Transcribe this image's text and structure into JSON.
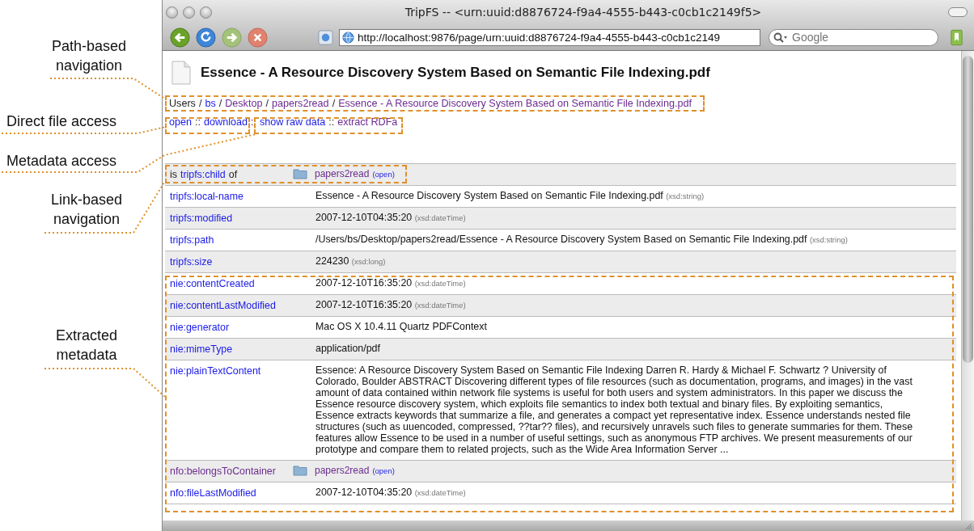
{
  "annotations": [
    {
      "text": "Path-based navigation"
    },
    {
      "text": "Direct file access"
    },
    {
      "text": "Metadata access"
    },
    {
      "text": "Link-based navigation"
    },
    {
      "text": "Extracted metadata"
    }
  ],
  "window": {
    "title": "TripFS -- <urn:uuid:d8876724-f9a4-4555-b443-c0cb1c2149f5>"
  },
  "toolbar": {
    "url": "http://localhost:9876/page/urn:uuid:d8876724-f9a4-4555-b443-c0cb1c2149",
    "search": {
      "placeholder": "Google"
    }
  },
  "page": {
    "title": "Essence - A Resource Discovery System Based on Semantic File Indexing.pdf",
    "breadcrumb": [
      {
        "kind": "text",
        "text": "Users"
      },
      {
        "kind": "separator",
        "text": "/"
      },
      {
        "kind": "link",
        "text": "bs",
        "visited": false
      },
      {
        "kind": "separator",
        "text": "/"
      },
      {
        "kind": "link",
        "text": "Desktop",
        "visited": true
      },
      {
        "kind": "separator",
        "text": "/"
      },
      {
        "kind": "link",
        "text": "papers2read",
        "visited": true
      },
      {
        "kind": "separator",
        "text": "/"
      },
      {
        "kind": "link",
        "text": "Essence - A Resource Discovery System Based on Semantic File Indexing.pdf",
        "visited": true
      }
    ],
    "actions": [
      {
        "kind": "link",
        "text": "open",
        "visited": false
      },
      {
        "kind": "separator",
        "text": "::"
      },
      {
        "kind": "link",
        "text": "download",
        "visited": false
      },
      {
        "kind": "separator",
        "text": "::"
      },
      {
        "kind": "link",
        "text": "show raw data",
        "visited": false
      },
      {
        "kind": "separator",
        "text": "::"
      },
      {
        "kind": "link",
        "text": "extract RDFa",
        "visited": true
      }
    ]
  },
  "table": {
    "rows": [
      {
        "property": {
          "prefix": "is",
          "link": "tripfs:child",
          "suffix": "of",
          "visited": false
        },
        "kind": "resource",
        "value": "papers2read",
        "visited": true,
        "action": "(open)"
      },
      {
        "property": {
          "link": "tripfs:local-name",
          "visited": false
        },
        "kind": "literal",
        "value": "Essence - A Resource Discovery System Based on Semantic File Indexing.pdf",
        "datatype": "(xsd:string)"
      },
      {
        "property": {
          "link": "tripfs:modified",
          "visited": false
        },
        "kind": "literal",
        "value": "2007-12-10T04:35:20",
        "datatype": "(xsd:dateTime)"
      },
      {
        "property": {
          "link": "tripfs:path",
          "visited": false
        },
        "kind": "literal",
        "value": "/Users/bs/Desktop/papers2read/Essence - A Resource Discovery System Based on Semantic File Indexing.pdf",
        "datatype": "(xsd:string)"
      },
      {
        "property": {
          "link": "tripfs:size",
          "visited": false
        },
        "kind": "literal",
        "value": "224230",
        "datatype": "(xsd:long)"
      },
      {
        "property": {
          "link": "nie:contentCreated",
          "visited": false
        },
        "kind": "literal",
        "value": "2007-12-10T16:35:20",
        "datatype": "(xsd:dateTime)"
      },
      {
        "property": {
          "link": "nie:contentLastModified",
          "visited": false
        },
        "kind": "literal",
        "value": "2007-12-10T16:35:20",
        "datatype": "(xsd:dateTime)"
      },
      {
        "property": {
          "link": "nie:generator",
          "visited": false
        },
        "kind": "literal",
        "value": "Mac OS X 10.4.11 Quartz PDFContext"
      },
      {
        "property": {
          "link": "nie:mimeType",
          "visited": false
        },
        "kind": "literal",
        "value": "application/pdf"
      },
      {
        "property": {
          "link": "nie:plainTextContent",
          "visited": false
        },
        "kind": "literal",
        "value": "Essence: A Resource Discovery System Based on Semantic File Indexing Darren R. Hardy & Michael F. Schwartz ? University of Colorado, Boulder ABSTRACT Discovering different types of file resources (such as documentation, programs, and images) in the vast amount of data contained within network file systems is useful for both users and system administrators. In this paper we discuss the Essence resource discovery system, which exploits file semantics to index both textual and binary files. By exploiting semantics, Essence extracts keywords that summarize a file, and generates a compact yet representative index. Essence understands nested file structures (such as uuencoded, compressed, ??tar?? files), and recursively unravels such files to generate summaries for them. These features allow Essence to be used in a number of useful settings, such as anonymous FTP archives. We present measurements of our prototype and compare them to related projects, such as the Wide Area Information Server ..."
      },
      {
        "property": {
          "link": "nfo:belongsToContainer",
          "visited": true
        },
        "kind": "resource",
        "value": "papers2read",
        "visited": true,
        "action": "(open)"
      },
      {
        "property": {
          "link": "nfo:fileLastModified",
          "visited": false
        },
        "kind": "literal",
        "value": "2007-12-10T04:35:20",
        "datatype": "(xsd:dateTime)"
      }
    ]
  }
}
